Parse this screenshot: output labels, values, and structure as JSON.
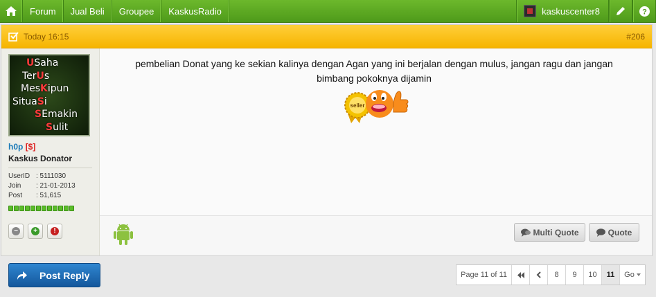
{
  "nav": {
    "items": [
      "Forum",
      "Jual Beli",
      "Groupee",
      "KaskusRadio"
    ],
    "username": "kaskuscenter8"
  },
  "post": {
    "time": "Today 16:15",
    "number": "#206",
    "author": {
      "name": "h0p",
      "badge": "[$]",
      "rank": "Kaskus Donator",
      "stats": [
        {
          "k": "UserID",
          "v": ": 5111030"
        },
        {
          "k": "Join",
          "v": ": 21-01-2013"
        },
        {
          "k": "Post",
          "v": ": 51,615"
        }
      ],
      "avatar_lines": [
        "USaha",
        "TerUs",
        "MesKipun",
        "SituaSi",
        "SEmakin",
        "Sulit"
      ],
      "reputation_bars": 12
    },
    "body_line1": "pembelian Donat yang ke sekian kalinya dengan Agan yang ini berjalan dengan mulus, jangan ragu dan jangan",
    "body_line2": "bimbang pokoknya dijamin",
    "seller_badge": "seller",
    "multi_quote": "Multi Quote",
    "quote": "Quote"
  },
  "reply_label": "Post Reply",
  "pagination": {
    "info": "Page 11 of 11",
    "pages": [
      "8",
      "9",
      "10",
      "11"
    ],
    "current": "11",
    "go": "Go"
  },
  "colors": {
    "nav": "#5aa823",
    "header": "#ffc21a",
    "reply": "#1f6fb8"
  }
}
